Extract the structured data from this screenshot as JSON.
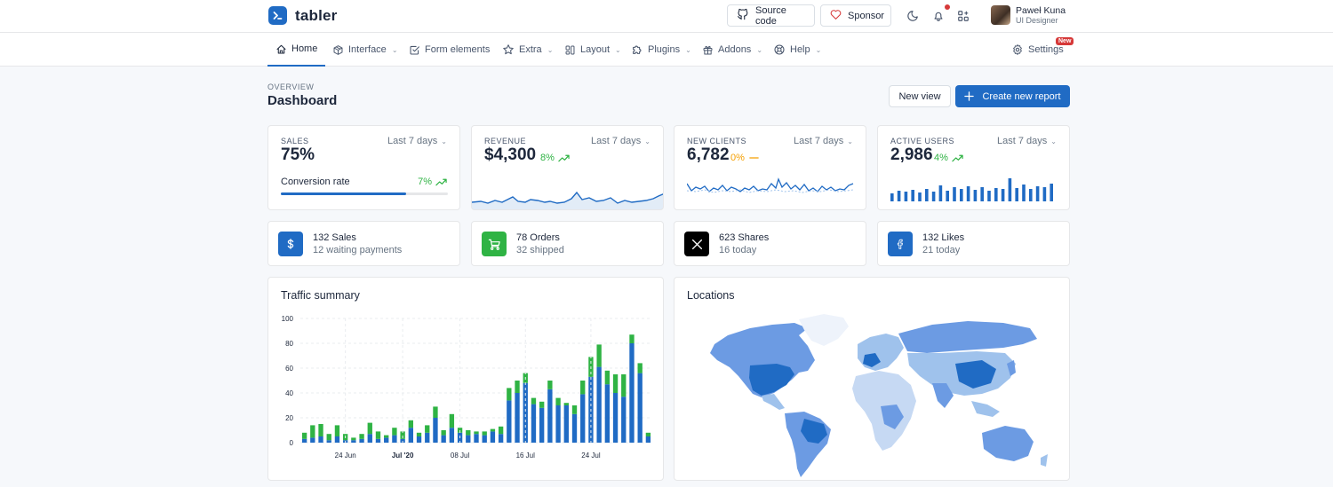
{
  "header": {
    "logo_text": "tabler",
    "source_code_label": "Source code",
    "sponsor_label": "Sponsor",
    "user": {
      "name": "Paweł Kuna",
      "role": "UI Designer"
    }
  },
  "nav": {
    "items": [
      {
        "label": "Home",
        "icon": "home-icon",
        "caret": false,
        "active": true
      },
      {
        "label": "Interface",
        "icon": "package-icon",
        "caret": true
      },
      {
        "label": "Form elements",
        "icon": "checkbox-icon",
        "caret": false
      },
      {
        "label": "Extra",
        "icon": "star-icon",
        "caret": true
      },
      {
        "label": "Layout",
        "icon": "layout-icon",
        "caret": true
      },
      {
        "label": "Plugins",
        "icon": "puzzle-icon",
        "caret": true
      },
      {
        "label": "Addons",
        "icon": "gift-icon",
        "caret": true
      },
      {
        "label": "Help",
        "icon": "lifebuoy-icon",
        "caret": true
      }
    ],
    "settings_label": "Settings",
    "settings_badge": "New"
  },
  "page": {
    "pretitle": "OVERVIEW",
    "title": "Dashboard",
    "new_view_label": "New view",
    "create_report_label": "Create new report"
  },
  "stats": {
    "sales": {
      "subheader": "SALES",
      "period": "Last 7 days",
      "value": "75%",
      "conversion_label": "Conversion rate",
      "conversion_delta": "7%",
      "progress": 0.75
    },
    "revenue": {
      "subheader": "REVENUE",
      "period": "Last 7 days",
      "value": "$4,300",
      "delta": "8%"
    },
    "clients": {
      "subheader": "NEW CLIENTS",
      "period": "Last 7 days",
      "value": "6,782",
      "delta": "0%"
    },
    "users": {
      "subheader": "ACTIVE USERS",
      "period": "Last 7 days",
      "value": "2,986",
      "delta": "4%"
    }
  },
  "mini_cards": [
    {
      "title": "132 Sales",
      "subtitle": "12 waiting payments",
      "icon": "currency-dollar-icon",
      "color": "#206bc4"
    },
    {
      "title": "78 Orders",
      "subtitle": "32 shipped",
      "icon": "shopping-cart-icon",
      "color": "#2fb344"
    },
    {
      "title": "623 Shares",
      "subtitle": "16 today",
      "icon": "x-brand-icon",
      "color": "#000000"
    },
    {
      "title": "132 Likes",
      "subtitle": "21 today",
      "icon": "facebook-icon",
      "color": "#3b5998"
    }
  ],
  "traffic": {
    "title": "Traffic summary"
  },
  "locations": {
    "title": "Locations"
  },
  "colors": {
    "primary": "#206bc4",
    "success": "#2fb344",
    "warning": "#f59f00",
    "danger": "#d63939"
  },
  "chart_data": {
    "type": "bar",
    "stacked": true,
    "ylim": [
      0,
      100
    ],
    "yticks": [
      0,
      20,
      40,
      60,
      80,
      100
    ],
    "x_tick_labels": [
      {
        "index": 5,
        "label": "24 Jun"
      },
      {
        "index": 12,
        "label": "Jul '20"
      },
      {
        "index": 19,
        "label": "08 Jul"
      },
      {
        "index": 27,
        "label": "16 Jul"
      },
      {
        "index": 35,
        "label": "24 Jul"
      }
    ],
    "series": [
      {
        "color": "#206bc4",
        "values": [
          3,
          4,
          5,
          2,
          5,
          2,
          2,
          3,
          7,
          3,
          4,
          6,
          3,
          12,
          5,
          8,
          20,
          6,
          12,
          8,
          6,
          7,
          6,
          9,
          7,
          34,
          40,
          48,
          31,
          28,
          43,
          30,
          30,
          23,
          39,
          53,
          61,
          47,
          40,
          37,
          80,
          56,
          5
        ]
      },
      {
        "color": "#2fb344",
        "values": [
          5,
          10,
          10,
          5,
          9,
          5,
          2,
          4,
          9,
          6,
          2,
          6,
          6,
          6,
          3,
          6,
          9,
          4,
          11,
          4,
          4,
          2,
          3,
          2,
          6,
          10,
          10,
          8,
          5,
          5,
          7,
          6,
          2,
          7,
          11,
          16,
          18,
          11,
          15,
          18,
          7,
          8,
          3
        ]
      }
    ]
  }
}
